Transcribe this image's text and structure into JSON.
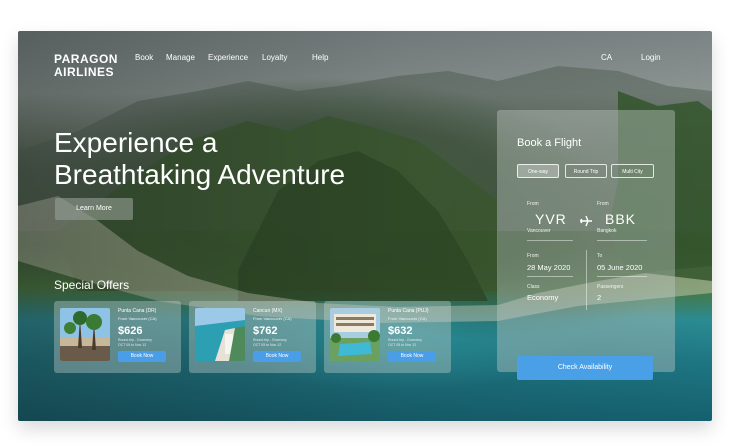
{
  "brand": {
    "line1": "PARAGON",
    "line2": "AIRLINES"
  },
  "nav": {
    "items": [
      "Book",
      "Manage",
      "Experience",
      "Loyalty",
      "Help"
    ],
    "country": "CA",
    "login": "Login"
  },
  "hero": {
    "title_line1": "Experience a",
    "title_line2": "Breathtaking Adventure",
    "button": "Learn More"
  },
  "offers": {
    "title": "Special Offers",
    "items": [
      {
        "destination": "Punta Cana (DR)",
        "from": "From Vancouver (CA)",
        "price": "$626",
        "note": "Round trip - Economy",
        "dates": "OCT 05 to Nov 12",
        "button": "Book Now",
        "thumb_icon": "palm-beach-image"
      },
      {
        "destination": "Cancun (MX)",
        "from": "From Vancouver (CA)",
        "price": "$762",
        "note": "Round trip - Economy",
        "dates": "OCT 05 to Nov 12",
        "button": "Book Now",
        "thumb_icon": "coastline-image"
      },
      {
        "destination": "Punta Cana (PUJ)",
        "from": "From Vancouver (CA)",
        "price": "$632",
        "note": "Round trip - Economy",
        "dates": "OCT 05 to Nov 12",
        "button": "Book Now",
        "thumb_icon": "resort-pool-image"
      }
    ]
  },
  "booking": {
    "title": "Book a Flight",
    "trip_types": [
      "One-way",
      "Round Trip",
      "Multi City"
    ],
    "active_trip": "One-way",
    "from_label": "From",
    "from_code": "YVR",
    "from_city": "Vancouver",
    "to_label": "From",
    "to_code": "BBK",
    "to_city": "Bangkok",
    "depart_label": "From",
    "depart_date": "28 May 2020",
    "return_label": "To",
    "return_date": "05 June 2020",
    "class_label": "Class",
    "class_value": "Economy",
    "passengers_label": "Passengers",
    "passengers_value": "2",
    "button": "Check Availability",
    "icon": "airplane-icon"
  },
  "colors": {
    "accent": "#4aa0e6",
    "text": "#ffffff"
  }
}
